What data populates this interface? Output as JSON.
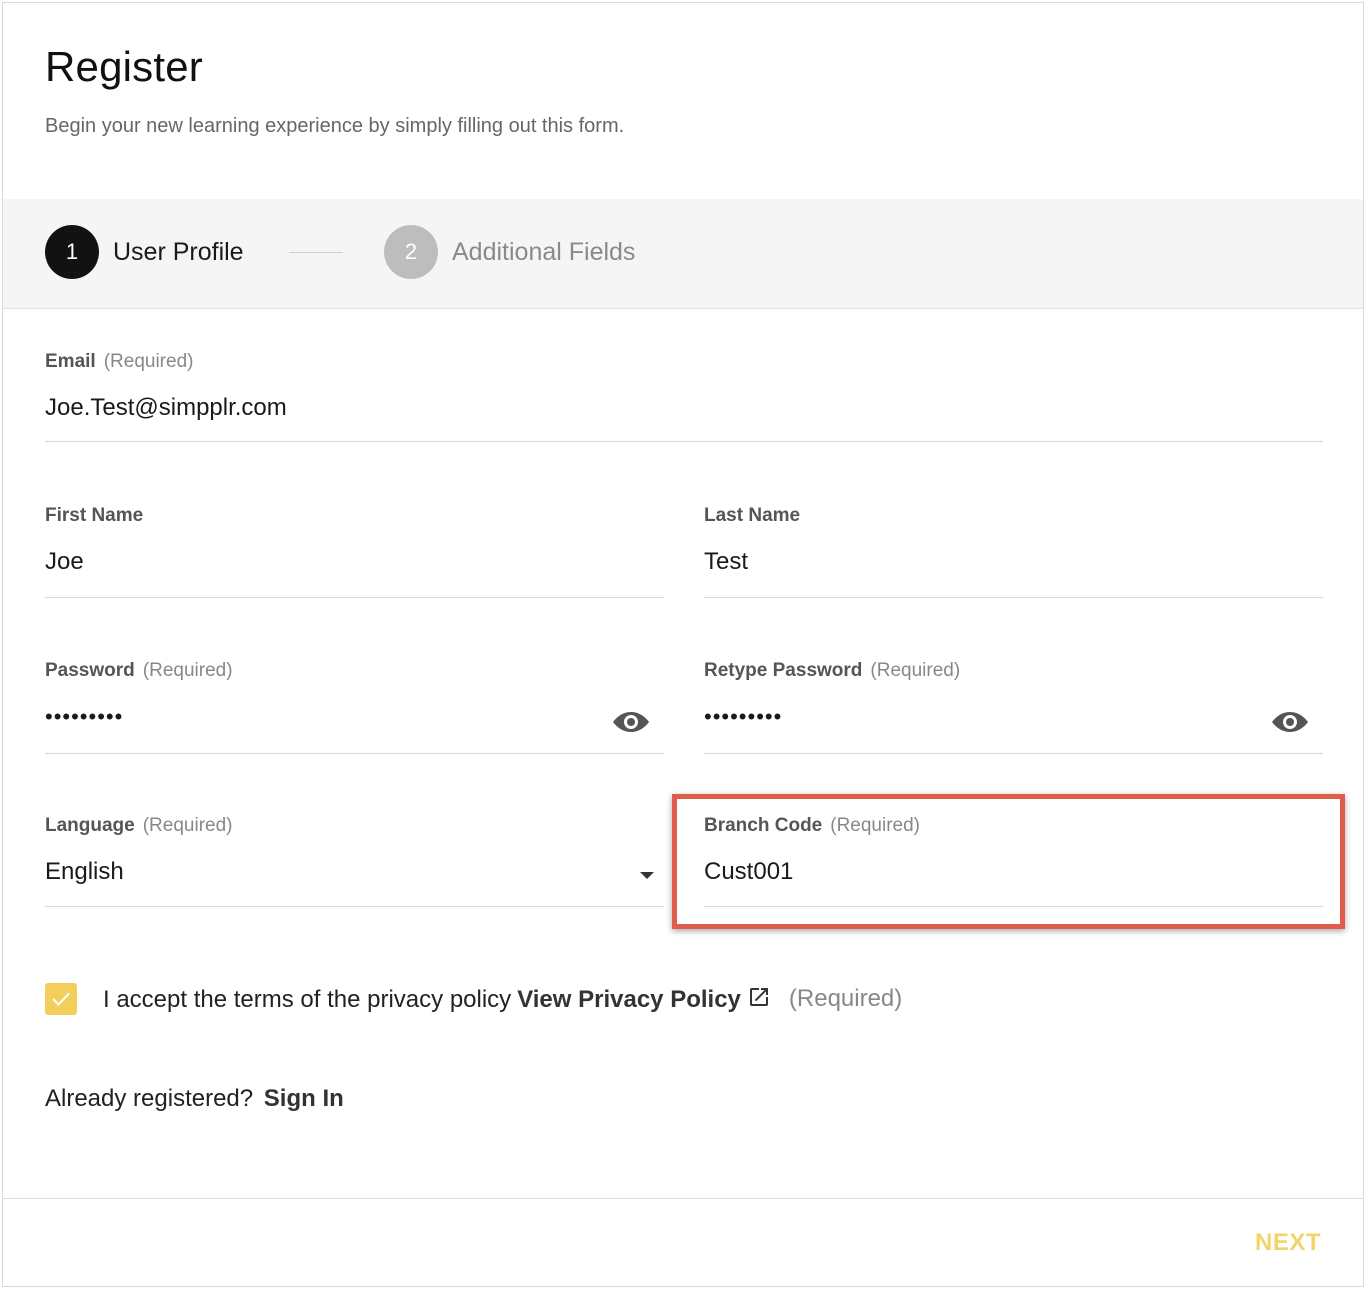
{
  "header": {
    "title": "Register",
    "subtitle": "Begin your new learning experience by simply filling out this form."
  },
  "stepper": {
    "steps": [
      {
        "number": "1",
        "label": "User Profile",
        "state": "active"
      },
      {
        "number": "2",
        "label": "Additional Fields",
        "state": "inactive"
      }
    ]
  },
  "form": {
    "email": {
      "label": "Email",
      "required": "(Required)",
      "value": "Joe.Test@simpplr.com"
    },
    "first_name": {
      "label": "First Name",
      "value": "Joe"
    },
    "last_name": {
      "label": "Last Name",
      "value": "Test"
    },
    "password": {
      "label": "Password",
      "required": "(Required)",
      "value": "•••••••••"
    },
    "retype_password": {
      "label": "Retype Password",
      "required": "(Required)",
      "value": "•••••••••"
    },
    "language": {
      "label": "Language",
      "required": "(Required)",
      "value": "English"
    },
    "branch_code": {
      "label": "Branch Code",
      "required": "(Required)",
      "value": "Cust001"
    }
  },
  "consent": {
    "checked": true,
    "text": "I accept the terms of the privacy policy",
    "link": "View Privacy Policy",
    "required": "(Required)"
  },
  "signin": {
    "text": "Already registered?",
    "link": "Sign In"
  },
  "footer": {
    "next_label": "NEXT"
  },
  "colors": {
    "accent": "#f2cf5b",
    "highlight": "#e05d4e",
    "step_active": "#121212",
    "step_inactive": "#bdbdbd"
  }
}
